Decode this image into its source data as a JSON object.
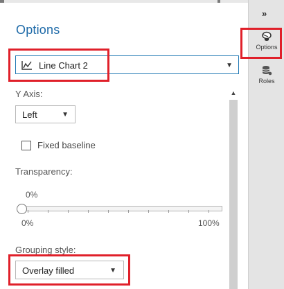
{
  "panel": {
    "title": "Options",
    "chart_selector": {
      "value": "Line Chart 2",
      "icon": "line-chart-icon"
    }
  },
  "y_axis": {
    "label": "Y Axis:",
    "value": "Left"
  },
  "fixed_baseline": {
    "label": "Fixed baseline",
    "checked": false
  },
  "transparency": {
    "label": "Transparency:",
    "value_text": "0%",
    "value": 0,
    "min_label": "0%",
    "max_label": "100%"
  },
  "grouping_style": {
    "label": "Grouping style:",
    "value": "Overlay filled"
  },
  "rail": {
    "collapse_glyph": "»",
    "buttons": [
      {
        "label": "Options",
        "icon": "options-icon"
      },
      {
        "label": "Roles",
        "icon": "roles-icon"
      }
    ]
  },
  "colors": {
    "accent": "#1e6aa8",
    "highlight": "#e0202a",
    "rail_bg": "#e4e4e4"
  }
}
